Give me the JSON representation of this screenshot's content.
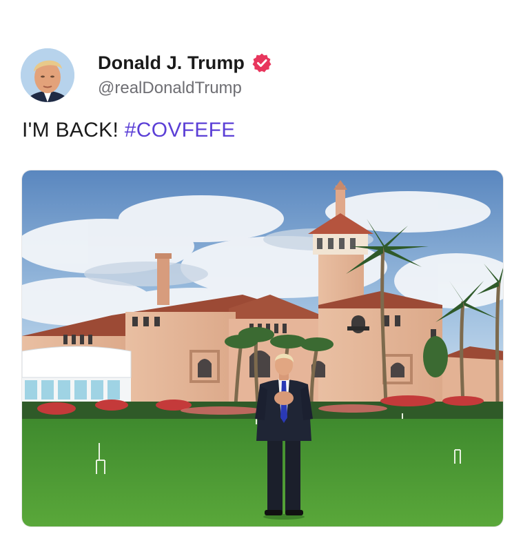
{
  "author": {
    "display_name": "Donald J. Trump",
    "handle": "@realDonaldTrump",
    "avatar_icon": "profile-photo",
    "verified_icon": "verified-badge-icon",
    "verified_color": "#e8365d"
  },
  "post": {
    "text": "I'M BACK!",
    "hashtag": "#COVFEFE",
    "hashtag_color": "#5b3fd6"
  },
  "media": {
    "type": "photo",
    "subject": "man in suit standing on croquet lawn in front of mansion with palm trees"
  }
}
